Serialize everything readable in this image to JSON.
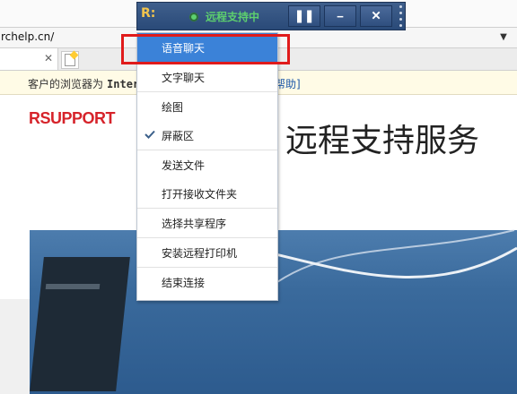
{
  "address_bar": {
    "url": "rchelp.cn/"
  },
  "info_bar": {
    "text_prefix": "客户的浏览器为",
    "browser": "Inter",
    "link_text": "帮助]"
  },
  "page": {
    "logo": "RSUPPORT",
    "title": "远程支持服务"
  },
  "toolbar": {
    "logo_label": "R:",
    "status": "远程支持中",
    "pause_icon": "pause-icon",
    "minimize_icon": "minimize-icon",
    "close_icon": "close-icon"
  },
  "menu": {
    "items": [
      {
        "label": "语音聊天",
        "selected": true
      },
      {
        "label": "文字聊天"
      },
      {
        "label": "绘图"
      },
      {
        "label": "屏蔽区",
        "checked": true
      },
      {
        "label": "发送文件"
      },
      {
        "label": "打开接收文件夹"
      },
      {
        "label": "选择共享程序"
      },
      {
        "label": "安装远程打印机"
      },
      {
        "label": "结束连接"
      }
    ]
  },
  "colors": {
    "selected": "#3b82d8",
    "highlight": "#e01b1b",
    "status_green": "#5dd06e",
    "logo_red": "#d6232a"
  }
}
